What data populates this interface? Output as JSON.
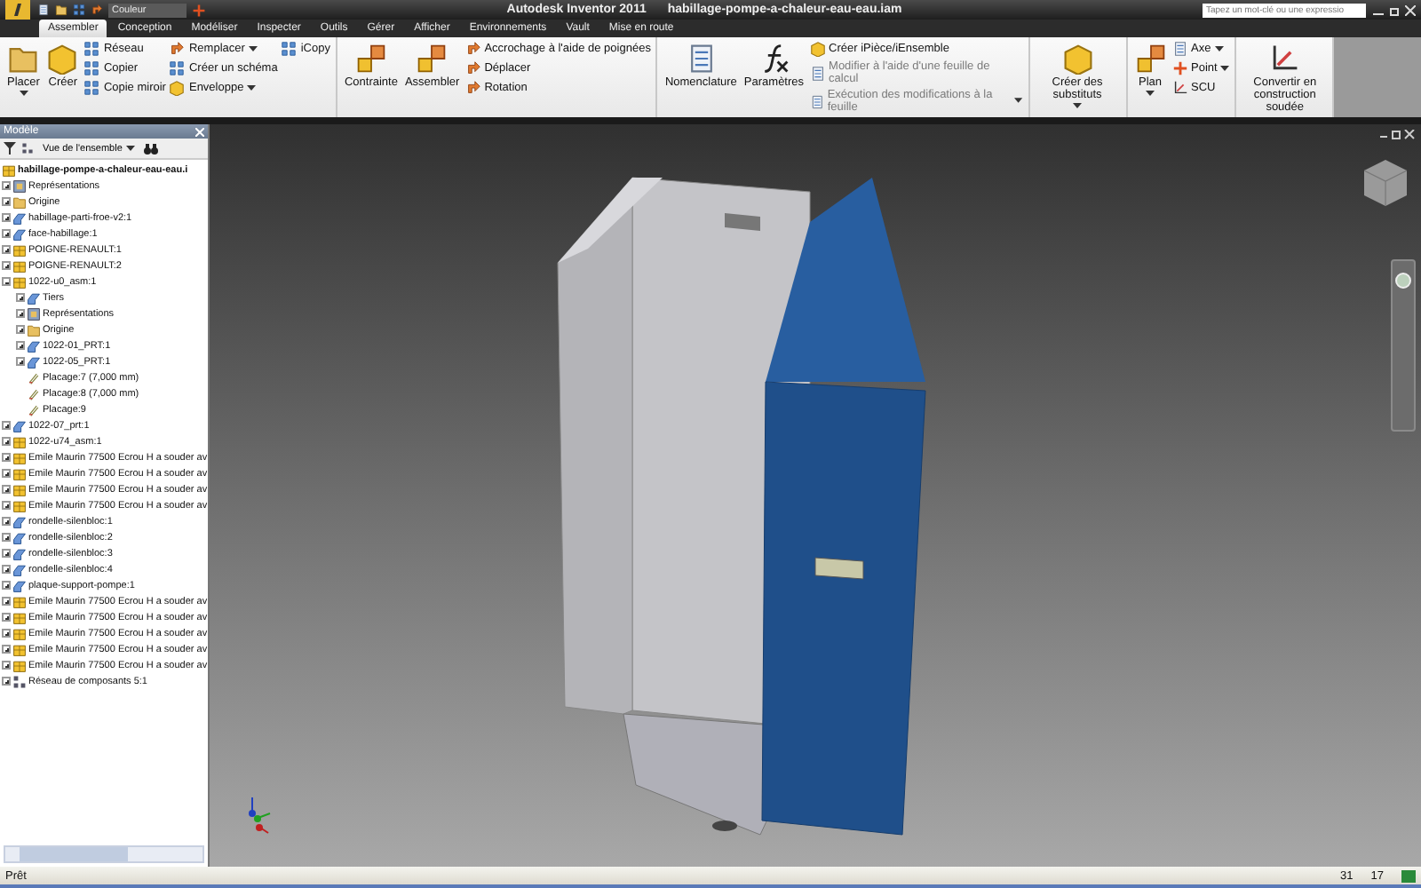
{
  "title_bar": {
    "app_title": "Autodesk Inventor 2011",
    "document_title": "habillage-pompe-a-chaleur-eau-eau.iam",
    "color_dropdown": {
      "placeholder": "Couleur"
    },
    "search": {
      "placeholder": "Tapez un mot-clé ou une expressio"
    }
  },
  "tabs": [
    {
      "label": "Assembler",
      "selected": true
    },
    {
      "label": "Conception",
      "selected": false
    },
    {
      "label": "Modéliser",
      "selected": false
    },
    {
      "label": "Inspecter",
      "selected": false
    },
    {
      "label": "Outils",
      "selected": false
    },
    {
      "label": "Gérer",
      "selected": false
    },
    {
      "label": "Afficher",
      "selected": false
    },
    {
      "label": "Environnements",
      "selected": false
    },
    {
      "label": "Vault",
      "selected": false
    },
    {
      "label": "Mise en route",
      "selected": false
    }
  ],
  "ribbon": {
    "groups": [
      {
        "large": [
          {
            "label": "Placer",
            "kind": "folder",
            "dropdown": true,
            "disabled": false
          },
          {
            "label": "Créer",
            "kind": "block",
            "dropdown": false,
            "disabled": false
          }
        ],
        "columns": [
          [
            {
              "label": "Réseau",
              "kind": "grid",
              "dropdown": false,
              "disabled": false
            },
            {
              "label": "Copier",
              "kind": "grid",
              "dropdown": false,
              "disabled": false
            },
            {
              "label": "Copie miroir",
              "kind": "grid",
              "dropdown": false,
              "disabled": false
            }
          ],
          [
            {
              "label": "Remplacer",
              "kind": "arrow",
              "dropdown": true,
              "disabled": false
            },
            {
              "label": "Créer un schéma",
              "kind": "grid",
              "dropdown": false,
              "disabled": false
            },
            {
              "label": "Enveloppe",
              "kind": "block",
              "dropdown": true,
              "disabled": false
            }
          ],
          [
            {
              "label": "iCopy",
              "kind": "grid",
              "dropdown": false,
              "disabled": false
            }
          ]
        ]
      },
      {
        "large": [
          {
            "label": "Contrainte",
            "kind": "squares",
            "dropdown": false,
            "disabled": false
          },
          {
            "label": "Assembler",
            "kind": "squares",
            "dropdown": false,
            "disabled": false
          }
        ],
        "columns": [
          [
            {
              "label": "Accrochage à l'aide de poignées",
              "kind": "arrow",
              "dropdown": false,
              "disabled": false
            },
            {
              "label": "Déplacer",
              "kind": "arrow",
              "dropdown": false,
              "disabled": false
            },
            {
              "label": "Rotation",
              "kind": "arrow",
              "dropdown": false,
              "disabled": false
            }
          ]
        ]
      },
      {
        "large": [
          {
            "label": "Nomenclature",
            "kind": "document",
            "dropdown": false,
            "disabled": false
          },
          {
            "label": "Paramètres",
            "kind": "curve",
            "dropdown": false,
            "disabled": false
          }
        ],
        "columns": [
          [
            {
              "label": "Créer iPièce/iEnsemble",
              "kind": "block",
              "dropdown": false,
              "disabled": false
            },
            {
              "label": "Modifier à l'aide d'une feuille de calcul",
              "kind": "document",
              "dropdown": false,
              "disabled": true
            },
            {
              "label": "Exécution des modifications à la feuille",
              "kind": "document",
              "dropdown": true,
              "disabled": true
            }
          ]
        ]
      },
      {
        "large": [
          {
            "label": "Créer des substituts",
            "kind": "block",
            "dropdown": true,
            "disabled": false
          }
        ]
      },
      {
        "large": [
          {
            "label": "Plan",
            "kind": "squares",
            "dropdown": true,
            "disabled": false
          }
        ],
        "columns": [
          [
            {
              "label": "Axe",
              "kind": "document",
              "dropdown": true,
              "disabled": false
            },
            {
              "label": "Point",
              "kind": "cross",
              "dropdown": true,
              "disabled": false
            },
            {
              "label": "SCU",
              "kind": "axes",
              "dropdown": false,
              "disabled": false
            }
          ]
        ]
      },
      {
        "large": [
          {
            "label": "Convertir en construction soudée",
            "kind": "axes",
            "dropdown": false,
            "disabled": false
          }
        ]
      }
    ]
  },
  "browser": {
    "title": "Modèle",
    "view_dropdown": "Vue de l'ensemble",
    "root": {
      "label": "habillage-pompe-a-chaleur-eau-eau.i",
      "kind": "assembly",
      "children": [
        {
          "label": "Représentations",
          "kind": "rep",
          "expanded": false
        },
        {
          "label": "Origine",
          "kind": "folder",
          "expanded": false
        },
        {
          "label": "habillage-parti-froe-v2:1",
          "kind": "part",
          "expanded": false
        },
        {
          "label": "face-habillage:1",
          "kind": "part",
          "expanded": false
        },
        {
          "label": "POIGNE-RENAULT:1",
          "kind": "assembly",
          "expanded": false
        },
        {
          "label": "POIGNE-RENAULT:2",
          "kind": "assembly",
          "expanded": false
        },
        {
          "label": "1022-u0_asm:1",
          "kind": "assembly",
          "expanded": true,
          "children": [
            {
              "label": "Tiers",
              "kind": "part",
              "expanded": false
            },
            {
              "label": "Représentations",
              "kind": "rep",
              "expanded": false
            },
            {
              "label": "Origine",
              "kind": "folder",
              "expanded": false
            },
            {
              "label": "1022-01_PRT:1",
              "kind": "part",
              "expanded": false
            },
            {
              "label": "1022-05_PRT:1",
              "kind": "part",
              "expanded": false
            },
            {
              "label": "Placage:7 (7,000 mm)",
              "kind": "feature"
            },
            {
              "label": "Placage:8 (7,000 mm)",
              "kind": "feature"
            },
            {
              "label": "Placage:9",
              "kind": "feature"
            }
          ]
        },
        {
          "label": "1022-07_prt:1",
          "kind": "part",
          "expanded": false
        },
        {
          "label": "1022-u74_asm:1",
          "kind": "assembly",
          "expanded": false
        },
        {
          "label": "Emile Maurin 77500 Ecrou H  a souder av",
          "kind": "assembly",
          "expanded": false
        },
        {
          "label": "Emile Maurin 77500 Ecrou H  a souder av",
          "kind": "assembly",
          "expanded": false
        },
        {
          "label": "Emile Maurin 77500 Ecrou H  a souder av",
          "kind": "assembly",
          "expanded": false
        },
        {
          "label": "Emile Maurin 77500 Ecrou H  a souder av",
          "kind": "assembly",
          "expanded": false
        },
        {
          "label": "rondelle-silenbloc:1",
          "kind": "part",
          "expanded": false
        },
        {
          "label": "rondelle-silenbloc:2",
          "kind": "part",
          "expanded": false
        },
        {
          "label": "rondelle-silenbloc:3",
          "kind": "part",
          "expanded": false
        },
        {
          "label": "rondelle-silenbloc:4",
          "kind": "part",
          "expanded": false
        },
        {
          "label": "plaque-support-pompe:1",
          "kind": "part",
          "expanded": false
        },
        {
          "label": "Emile Maurin 77500 Ecrou H  a souder av",
          "kind": "assembly",
          "expanded": false
        },
        {
          "label": "Emile Maurin 77500 Ecrou H  a souder av",
          "kind": "assembly",
          "expanded": false
        },
        {
          "label": "Emile Maurin 77500 Ecrou H  a souder av",
          "kind": "assembly",
          "expanded": false
        },
        {
          "label": "Emile Maurin 77500 Ecrou H  a souder av",
          "kind": "assembly",
          "expanded": false
        },
        {
          "label": "Emile Maurin 77500 Ecrou H  a souder av",
          "kind": "assembly",
          "expanded": false
        },
        {
          "label": "Réseau de composants 5:1",
          "kind": "pattern",
          "expanded": false
        }
      ]
    }
  },
  "status_bar": {
    "message": "Prêt",
    "count_1": "31",
    "count_2": "17"
  }
}
